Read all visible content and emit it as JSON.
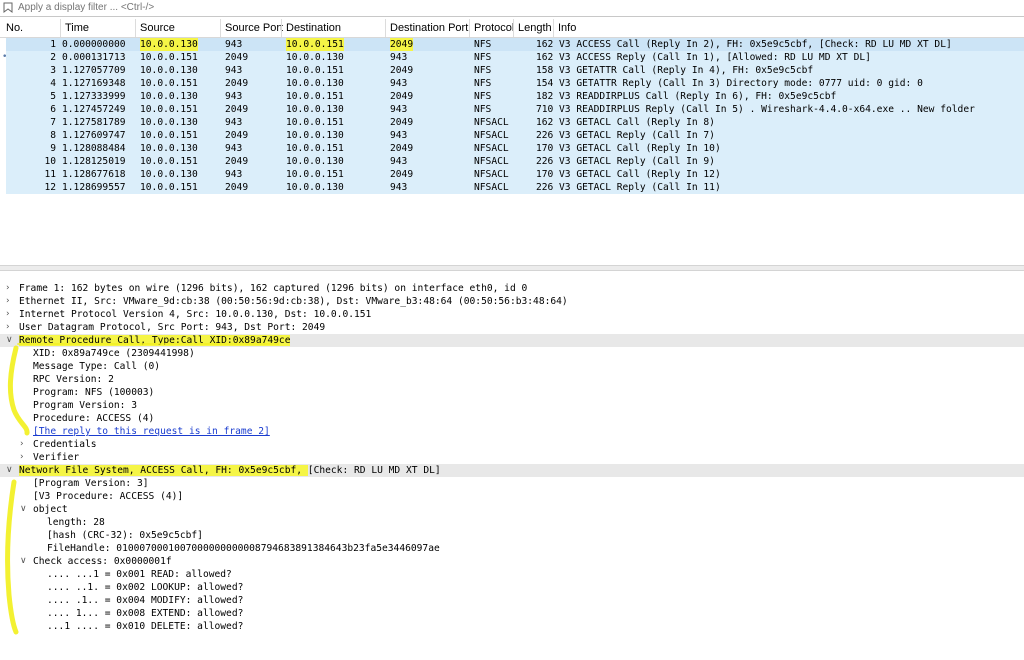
{
  "filter": {
    "placeholder": "Apply a display filter ... <Ctrl-/>"
  },
  "columns": [
    "No.",
    "Time",
    "Source",
    "Source Port",
    "Destination",
    "Destination Port",
    "Protocol",
    "Length",
    "Info"
  ],
  "packets": [
    {
      "no": "1",
      "time": "0.000000000",
      "src": "10.0.0.130",
      "sport": "943",
      "dst": "10.0.0.151",
      "dport": "2049",
      "proto": "NFS",
      "len": "162",
      "info": "V3 ACCESS Call (Reply In 2), FH: 0x5e9c5cbf, [Check: RD LU MD XT DL]"
    },
    {
      "no": "2",
      "time": "0.000131713",
      "src": "10.0.0.151",
      "sport": "2049",
      "dst": "10.0.0.130",
      "dport": "943",
      "proto": "NFS",
      "len": "162",
      "info": "V3 ACCESS Reply (Call In 1), [Allowed: RD LU MD XT DL]"
    },
    {
      "no": "3",
      "time": "1.127057709",
      "src": "10.0.0.130",
      "sport": "943",
      "dst": "10.0.0.151",
      "dport": "2049",
      "proto": "NFS",
      "len": "158",
      "info": "V3 GETATTR Call (Reply In 4), FH: 0x5e9c5cbf"
    },
    {
      "no": "4",
      "time": "1.127169348",
      "src": "10.0.0.151",
      "sport": "2049",
      "dst": "10.0.0.130",
      "dport": "943",
      "proto": "NFS",
      "len": "154",
      "info": "V3 GETATTR Reply (Call In 3)  Directory mode: 0777 uid: 0 gid: 0"
    },
    {
      "no": "5",
      "time": "1.127333999",
      "src": "10.0.0.130",
      "sport": "943",
      "dst": "10.0.0.151",
      "dport": "2049",
      "proto": "NFS",
      "len": "182",
      "info": "V3 READDIRPLUS Call (Reply In 6), FH: 0x5e9c5cbf"
    },
    {
      "no": "6",
      "time": "1.127457249",
      "src": "10.0.0.151",
      "sport": "2049",
      "dst": "10.0.0.130",
      "dport": "943",
      "proto": "NFS",
      "len": "710",
      "info": "V3 READDIRPLUS Reply (Call In 5) . Wireshark-4.4.0-x64.exe .. New folder"
    },
    {
      "no": "7",
      "time": "1.127581789",
      "src": "10.0.0.130",
      "sport": "943",
      "dst": "10.0.0.151",
      "dport": "2049",
      "proto": "NFSACL",
      "len": "162",
      "info": "V3 GETACL Call (Reply In 8)"
    },
    {
      "no": "8",
      "time": "1.127609747",
      "src": "10.0.0.151",
      "sport": "2049",
      "dst": "10.0.0.130",
      "dport": "943",
      "proto": "NFSACL",
      "len": "226",
      "info": "V3 GETACL Reply (Call In 7)"
    },
    {
      "no": "9",
      "time": "1.128088484",
      "src": "10.0.0.130",
      "sport": "943",
      "dst": "10.0.0.151",
      "dport": "2049",
      "proto": "NFSACL",
      "len": "170",
      "info": "V3 GETACL Call (Reply In 10)"
    },
    {
      "no": "10",
      "time": "1.128125019",
      "src": "10.0.0.151",
      "sport": "2049",
      "dst": "10.0.0.130",
      "dport": "943",
      "proto": "NFSACL",
      "len": "226",
      "info": "V3 GETACL Reply (Call In 9)"
    },
    {
      "no": "11",
      "time": "1.128677618",
      "src": "10.0.0.130",
      "sport": "943",
      "dst": "10.0.0.151",
      "dport": "2049",
      "proto": "NFSACL",
      "len": "170",
      "info": "V3 GETACL Call (Reply In 12)"
    },
    {
      "no": "12",
      "time": "1.128699557",
      "src": "10.0.0.151",
      "sport": "2049",
      "dst": "10.0.0.130",
      "dport": "943",
      "proto": "NFSACL",
      "len": "226",
      "info": "V3 GETACL Reply (Call In 11)"
    }
  ],
  "selected_row_marker": "•",
  "details": [
    {
      "text": "Frame 1: 162 bytes on wire (1296 bits), 162 captured (1296 bits) on interface eth0, id 0",
      "arrow": "collapsed",
      "link": false,
      "header": false
    },
    {
      "text": "Ethernet II, Src: VMware_9d:cb:38 (00:50:56:9d:cb:38), Dst: VMware_b3:48:64 (00:50:56:b3:48:64)",
      "arrow": "collapsed",
      "link": false,
      "header": false
    },
    {
      "text": "Internet Protocol Version 4, Src: 10.0.0.130, Dst: 10.0.0.151",
      "arrow": "collapsed",
      "link": false,
      "header": false
    },
    {
      "text": "User Datagram Protocol, Src Port: 943, Dst Port: 2049",
      "arrow": "collapsed",
      "link": false,
      "header": false
    },
    {
      "text": "Remote Procedure Call, Type:Call XID:0x89a749ce",
      "arrow": "expanded",
      "link": false,
      "header": true
    },
    {
      "text": "XID: 0x89a749ce (2309441998)",
      "arrow": "none",
      "link": false,
      "header": false
    },
    {
      "text": "Message Type: Call (0)",
      "arrow": "none",
      "link": false,
      "header": false
    },
    {
      "text": "RPC Version: 2",
      "arrow": "none",
      "link": false,
      "header": false
    },
    {
      "text": "Program: NFS (100003)",
      "arrow": "none",
      "link": false,
      "header": false
    },
    {
      "text": "Program Version: 3",
      "arrow": "none",
      "link": false,
      "header": false
    },
    {
      "text": "Procedure: ACCESS (4)",
      "arrow": "none",
      "link": false,
      "header": false
    },
    {
      "text": "[The reply to this request is in frame 2]",
      "arrow": "none",
      "link": true,
      "header": false
    },
    {
      "text": "Credentials",
      "arrow": "collapsed",
      "link": false,
      "header": false
    },
    {
      "text": "Verifier",
      "arrow": "collapsed",
      "link": false,
      "header": false
    },
    {
      "text": "Network File System, ACCESS Call, FH: 0x5e9c5cbf, [Check: RD LU MD XT DL]",
      "arrow": "expanded",
      "link": false,
      "header": true
    },
    {
      "text": "[Program Version: 3]",
      "arrow": "none",
      "link": false,
      "header": false
    },
    {
      "text": "[V3 Procedure: ACCESS (4)]",
      "arrow": "none",
      "link": false,
      "header": false
    },
    {
      "text": "object",
      "arrow": "expanded",
      "link": false,
      "header": false
    },
    {
      "text": "length: 28",
      "arrow": "none",
      "link": false,
      "header": false
    },
    {
      "text": "[hash (CRC-32): 0x5e9c5cbf]",
      "arrow": "none",
      "link": false,
      "header": false
    },
    {
      "text": "FileHandle: 0100070001007000000000008794683891384643b23fa5e3446097ae",
      "arrow": "none",
      "link": false,
      "header": false
    },
    {
      "text": "Check access: 0x0000001f",
      "arrow": "expanded",
      "link": false,
      "header": false
    },
    {
      "text": ".... ...1 = 0x001 READ: allowed?",
      "arrow": "none",
      "link": false,
      "header": false
    },
    {
      "text": ".... ..1. = 0x002 LOOKUP: allowed?",
      "arrow": "none",
      "link": false,
      "header": false
    },
    {
      "text": ".... .1.. = 0x004 MODIFY: allowed?",
      "arrow": "none",
      "link": false,
      "header": false
    },
    {
      "text": ".... 1... = 0x008 EXTEND: allowed?",
      "arrow": "none",
      "link": false,
      "header": false
    },
    {
      "text": "...1 .... = 0x010 DELETE: allowed?",
      "arrow": "none",
      "link": false,
      "header": false
    }
  ],
  "colors": {
    "row_bg": "#dbeefa",
    "selected_row_bg": "#cce4f6",
    "highlight": "#f5f546",
    "link": "#1a3ccf"
  }
}
